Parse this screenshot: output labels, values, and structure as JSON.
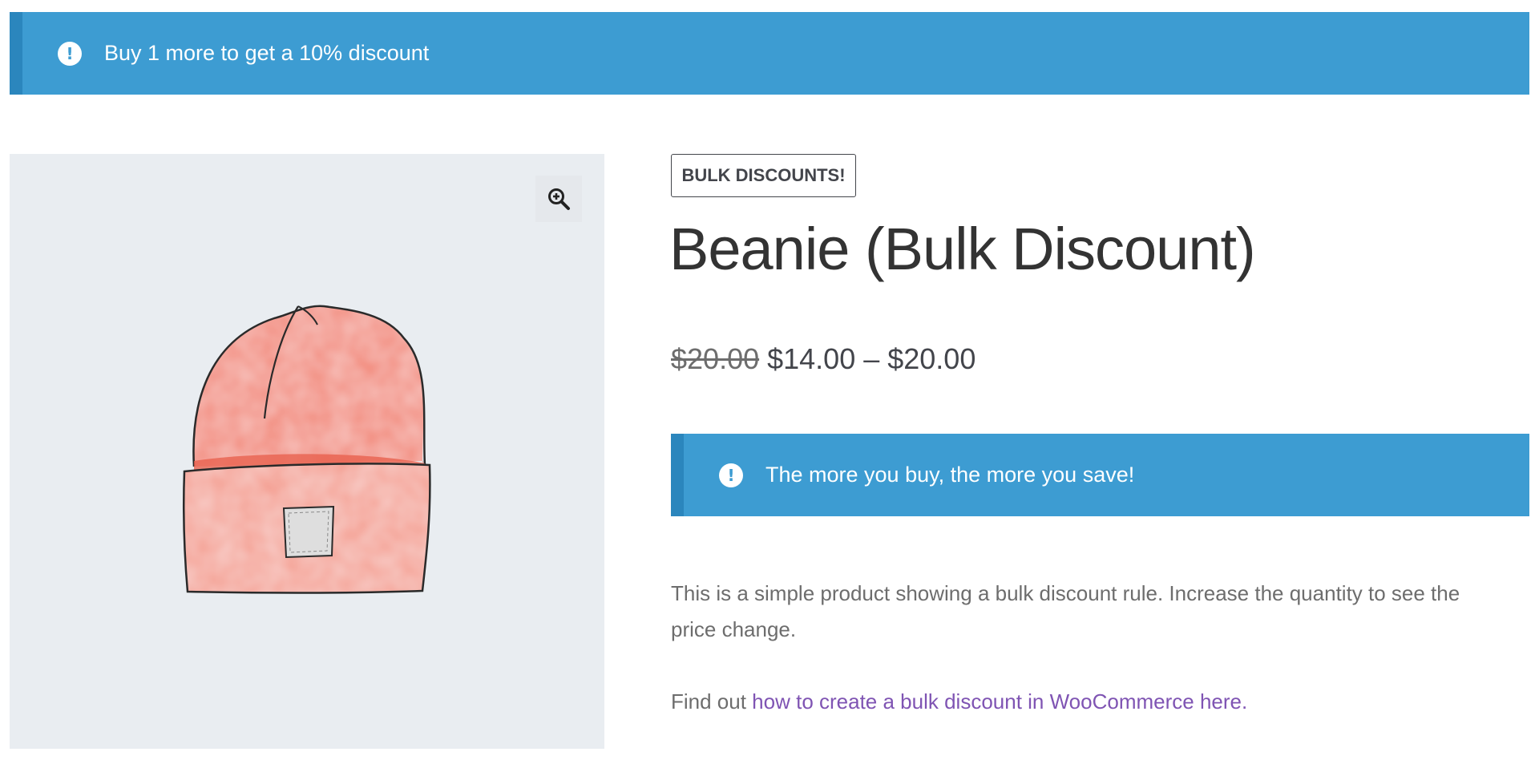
{
  "notice_top": {
    "icon": "exclamation-circle-icon",
    "text": "Buy 1 more to get a 10% discount"
  },
  "gallery": {
    "zoom_icon": "zoom-in-icon",
    "image": "beanie-hat-illustration"
  },
  "product": {
    "badge": "BULK DISCOUNTS!",
    "title": "Beanie (Bulk Discount)",
    "price_old": "$20.00",
    "price_range": "$14.00 – $20.00",
    "notice": {
      "icon": "exclamation-circle-icon",
      "text": "The more you buy, the more you save!"
    },
    "description": "This is a simple product showing a bulk discount rule. Increase the quantity to see the price change.",
    "find_out_prefix": "Find out ",
    "find_out_link": "how to create a bulk discount in WooCommerce here."
  },
  "colors": {
    "notice_bg": "#3d9cd2",
    "notice_border": "#2b86bd",
    "link": "#7f54b3",
    "gallery_bg": "#e9edf1",
    "beanie": "#f07b6b"
  }
}
